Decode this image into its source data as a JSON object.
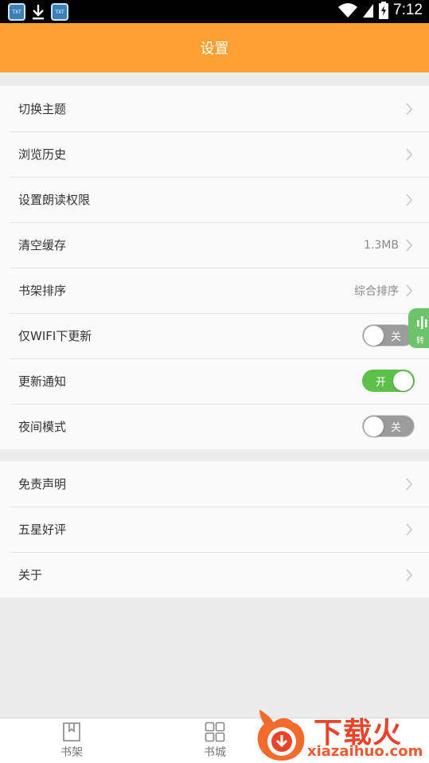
{
  "status_bar": {
    "time": "7:12",
    "notif_icons": [
      "app-notification-icon",
      "download-icon",
      "app-notification-icon"
    ],
    "app_icon_text": "TXT"
  },
  "header": {
    "title": "设置"
  },
  "settings_group_1": [
    {
      "label": "切换主题",
      "value": "",
      "control": "chevron"
    },
    {
      "label": "浏览历史",
      "value": "",
      "control": "chevron"
    },
    {
      "label": "设置朗读权限",
      "value": "",
      "control": "chevron"
    },
    {
      "label": "清空缓存",
      "value": "1.3MB",
      "control": "chevron"
    },
    {
      "label": "书架排序",
      "value": "综合排序",
      "control": "chevron"
    },
    {
      "label": "仅WIFI下更新",
      "control": "toggle",
      "state": "off",
      "toggle_text": "关"
    },
    {
      "label": "更新通知",
      "control": "toggle",
      "state": "on",
      "toggle_text": "开"
    },
    {
      "label": "夜间模式",
      "control": "toggle",
      "state": "off",
      "toggle_text": "关"
    }
  ],
  "settings_group_2": [
    {
      "label": "免责声明",
      "control": "chevron"
    },
    {
      "label": "五星好评",
      "control": "chevron"
    },
    {
      "label": "关于",
      "control": "chevron"
    }
  ],
  "floating_widget": {
    "text": "转"
  },
  "bottom_nav": [
    {
      "label": "书架",
      "icon": "bookshelf-icon"
    },
    {
      "label": "书城",
      "icon": "grid-icon"
    }
  ],
  "watermark": {
    "brand": "下载火",
    "url": "xiazaihuo.com"
  },
  "colors": {
    "header": "#ffa033",
    "toggle_on": "#5cc04a",
    "toggle_off": "#9b9b9b",
    "background": "#ececec",
    "watermark": "#e8442a"
  }
}
